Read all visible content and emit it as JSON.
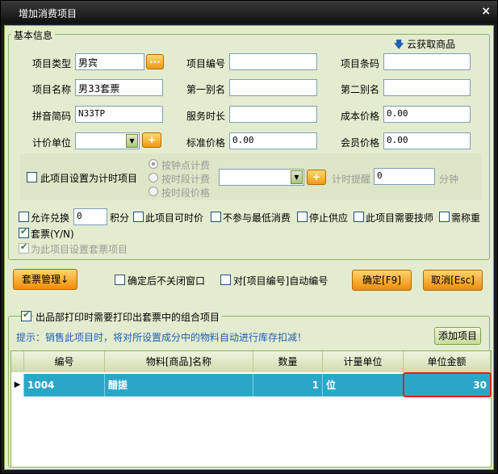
{
  "window": {
    "title": "增加消费项目",
    "close": "×"
  },
  "basic": {
    "legend": "基本信息",
    "cloud_button": "云获取商品",
    "fields": {
      "type_label": "项目类型",
      "type_value": "男宾",
      "type_btn": "...",
      "code_label": "项目编号",
      "code_value": "",
      "barcode_label": "项目条码",
      "barcode_value": "",
      "name_label": "项目名称",
      "name_value": "男33套票",
      "alias1_label": "第一别名",
      "alias1_value": "",
      "alias2_label": "第二别名",
      "alias2_value": "",
      "pinyin_label": "拼音简码",
      "pinyin_value": "N33TP",
      "duration_label": "服务时长",
      "duration_value": "",
      "cost_label": "成本价格",
      "cost_value": "0.00",
      "unit_label": "计价单位",
      "unit_value": "",
      "unit_btn": "+",
      "std_label": "标准价格",
      "std_value": "0.00",
      "member_label": "会员价格",
      "member_value": "0.00"
    },
    "timed": {
      "checkbox_label": "此项目设置为计时项目",
      "radio1": "按钟点计费",
      "radio2": "按时段计费",
      "radio3": "按时段价格",
      "period_btn": "+",
      "remind_label": "计时提醒",
      "remind_value": "0",
      "remind_unit": "分钟"
    },
    "options": {
      "exchange_label": "允许兑换",
      "exchange_value": "0",
      "points_label": "积分",
      "timeprice_label": "此项目可时价",
      "nomin_label": "不参与最低消费",
      "stop_label": "停止供应",
      "tech_label": "此项目需要技师",
      "weigh_label": "需称重",
      "package_label": "套票(Y/N)",
      "setpackage_label": "为此项目设置套票项目"
    }
  },
  "actions": {
    "package_mgmt": "套票管理↓",
    "keep_open": "确定后不关闭窗口",
    "auto_number": "对[项目编号]自动编号",
    "ok": "确定[F9]",
    "cancel": "取消[Esc]"
  },
  "combo": {
    "legend": "出品部打印时需要打印出套票中的组合项目",
    "hint": "提示：销售此项目时，将对所设置成分中的物料自动进行库存扣减！",
    "add_button": "添加项目",
    "columns": [
      "编号",
      "物料[商品]名称",
      "数量",
      "计量单位",
      "单位金额"
    ],
    "rows": [
      {
        "code": "1004",
        "name": "醋搓",
        "qty": "1",
        "unit": "位",
        "price": "30"
      }
    ]
  },
  "colors": {
    "accent": "#f09a10",
    "row_selected": "#2aa7c8",
    "panel": "#e4ecd0",
    "highlight": "#e02020"
  }
}
